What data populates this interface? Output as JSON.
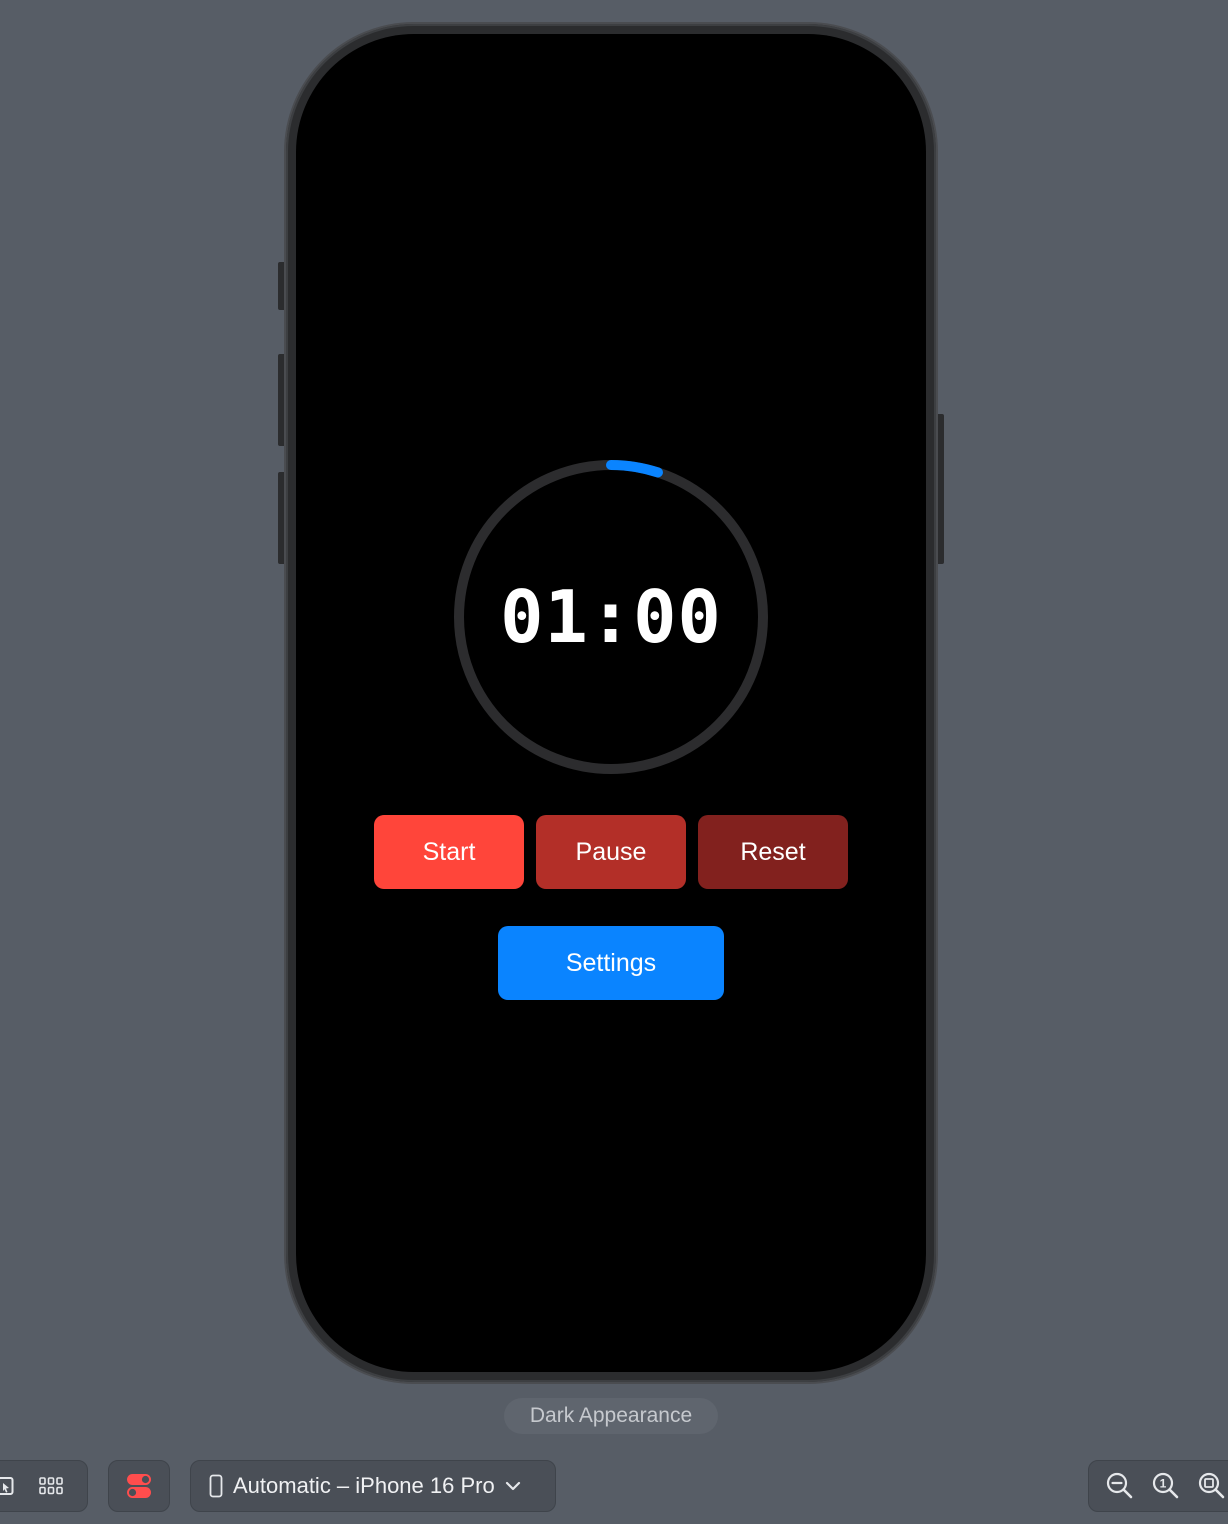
{
  "timer": {
    "time": "01:00",
    "progress": 0.05,
    "track_color": "#2c2c2e",
    "progress_color": "#0a84ff"
  },
  "buttons": {
    "start": "Start",
    "pause": "Pause",
    "reset": "Reset",
    "settings": "Settings"
  },
  "colors": {
    "start": "#ff453a",
    "pause": "#b32f28",
    "reset": "#82211e",
    "settings": "#0a84ff",
    "background": "#575d66"
  },
  "appearance_label": "Dark Appearance",
  "toolbar": {
    "left_icons": [
      "select-icon",
      "grid-icon"
    ],
    "variants_icon": "variants-toggle-icon",
    "device_icon": "iphone-icon",
    "device_label": "Automatic – iPhone 16 Pro",
    "device_chevron": "chevron-down-icon",
    "zoom_icons": [
      "zoom-out-icon",
      "zoom-actual-size-icon",
      "zoom-to-fit-icon"
    ],
    "zoom_actual_glyph": "1"
  }
}
